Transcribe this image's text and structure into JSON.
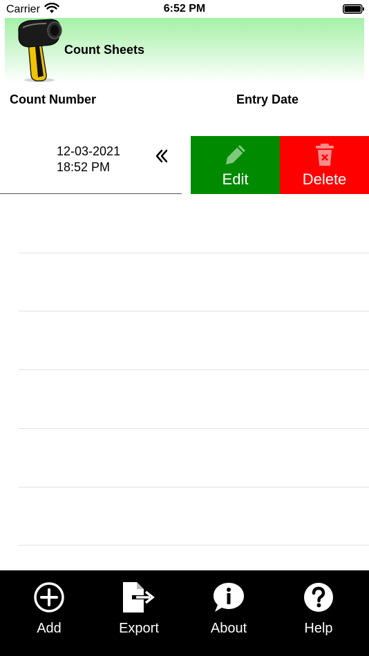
{
  "status": {
    "carrier": "Carrier",
    "time": "6:52 PM"
  },
  "header": {
    "title": "Count Sheets",
    "logo_icon": "barcode-scanner-icon"
  },
  "columns": {
    "count_number": "Count Number",
    "entry_date": "Entry Date"
  },
  "rows": [
    {
      "date": "12-03-2021",
      "time": "18:52 PM",
      "chevron_icon": "double-chevron-left-icon"
    }
  ],
  "row_actions": {
    "edit": {
      "label": "Edit",
      "icon": "pencil-icon",
      "color": "#008a00"
    },
    "delete": {
      "label": "Delete",
      "icon": "trash-icon",
      "color": "#ff0000"
    }
  },
  "tabs": [
    {
      "label": "Add",
      "icon": "plus-circle-icon"
    },
    {
      "label": "Export",
      "icon": "export-icon"
    },
    {
      "label": "About",
      "icon": "info-bubble-icon"
    },
    {
      "label": "Help",
      "icon": "question-circle-icon"
    }
  ]
}
